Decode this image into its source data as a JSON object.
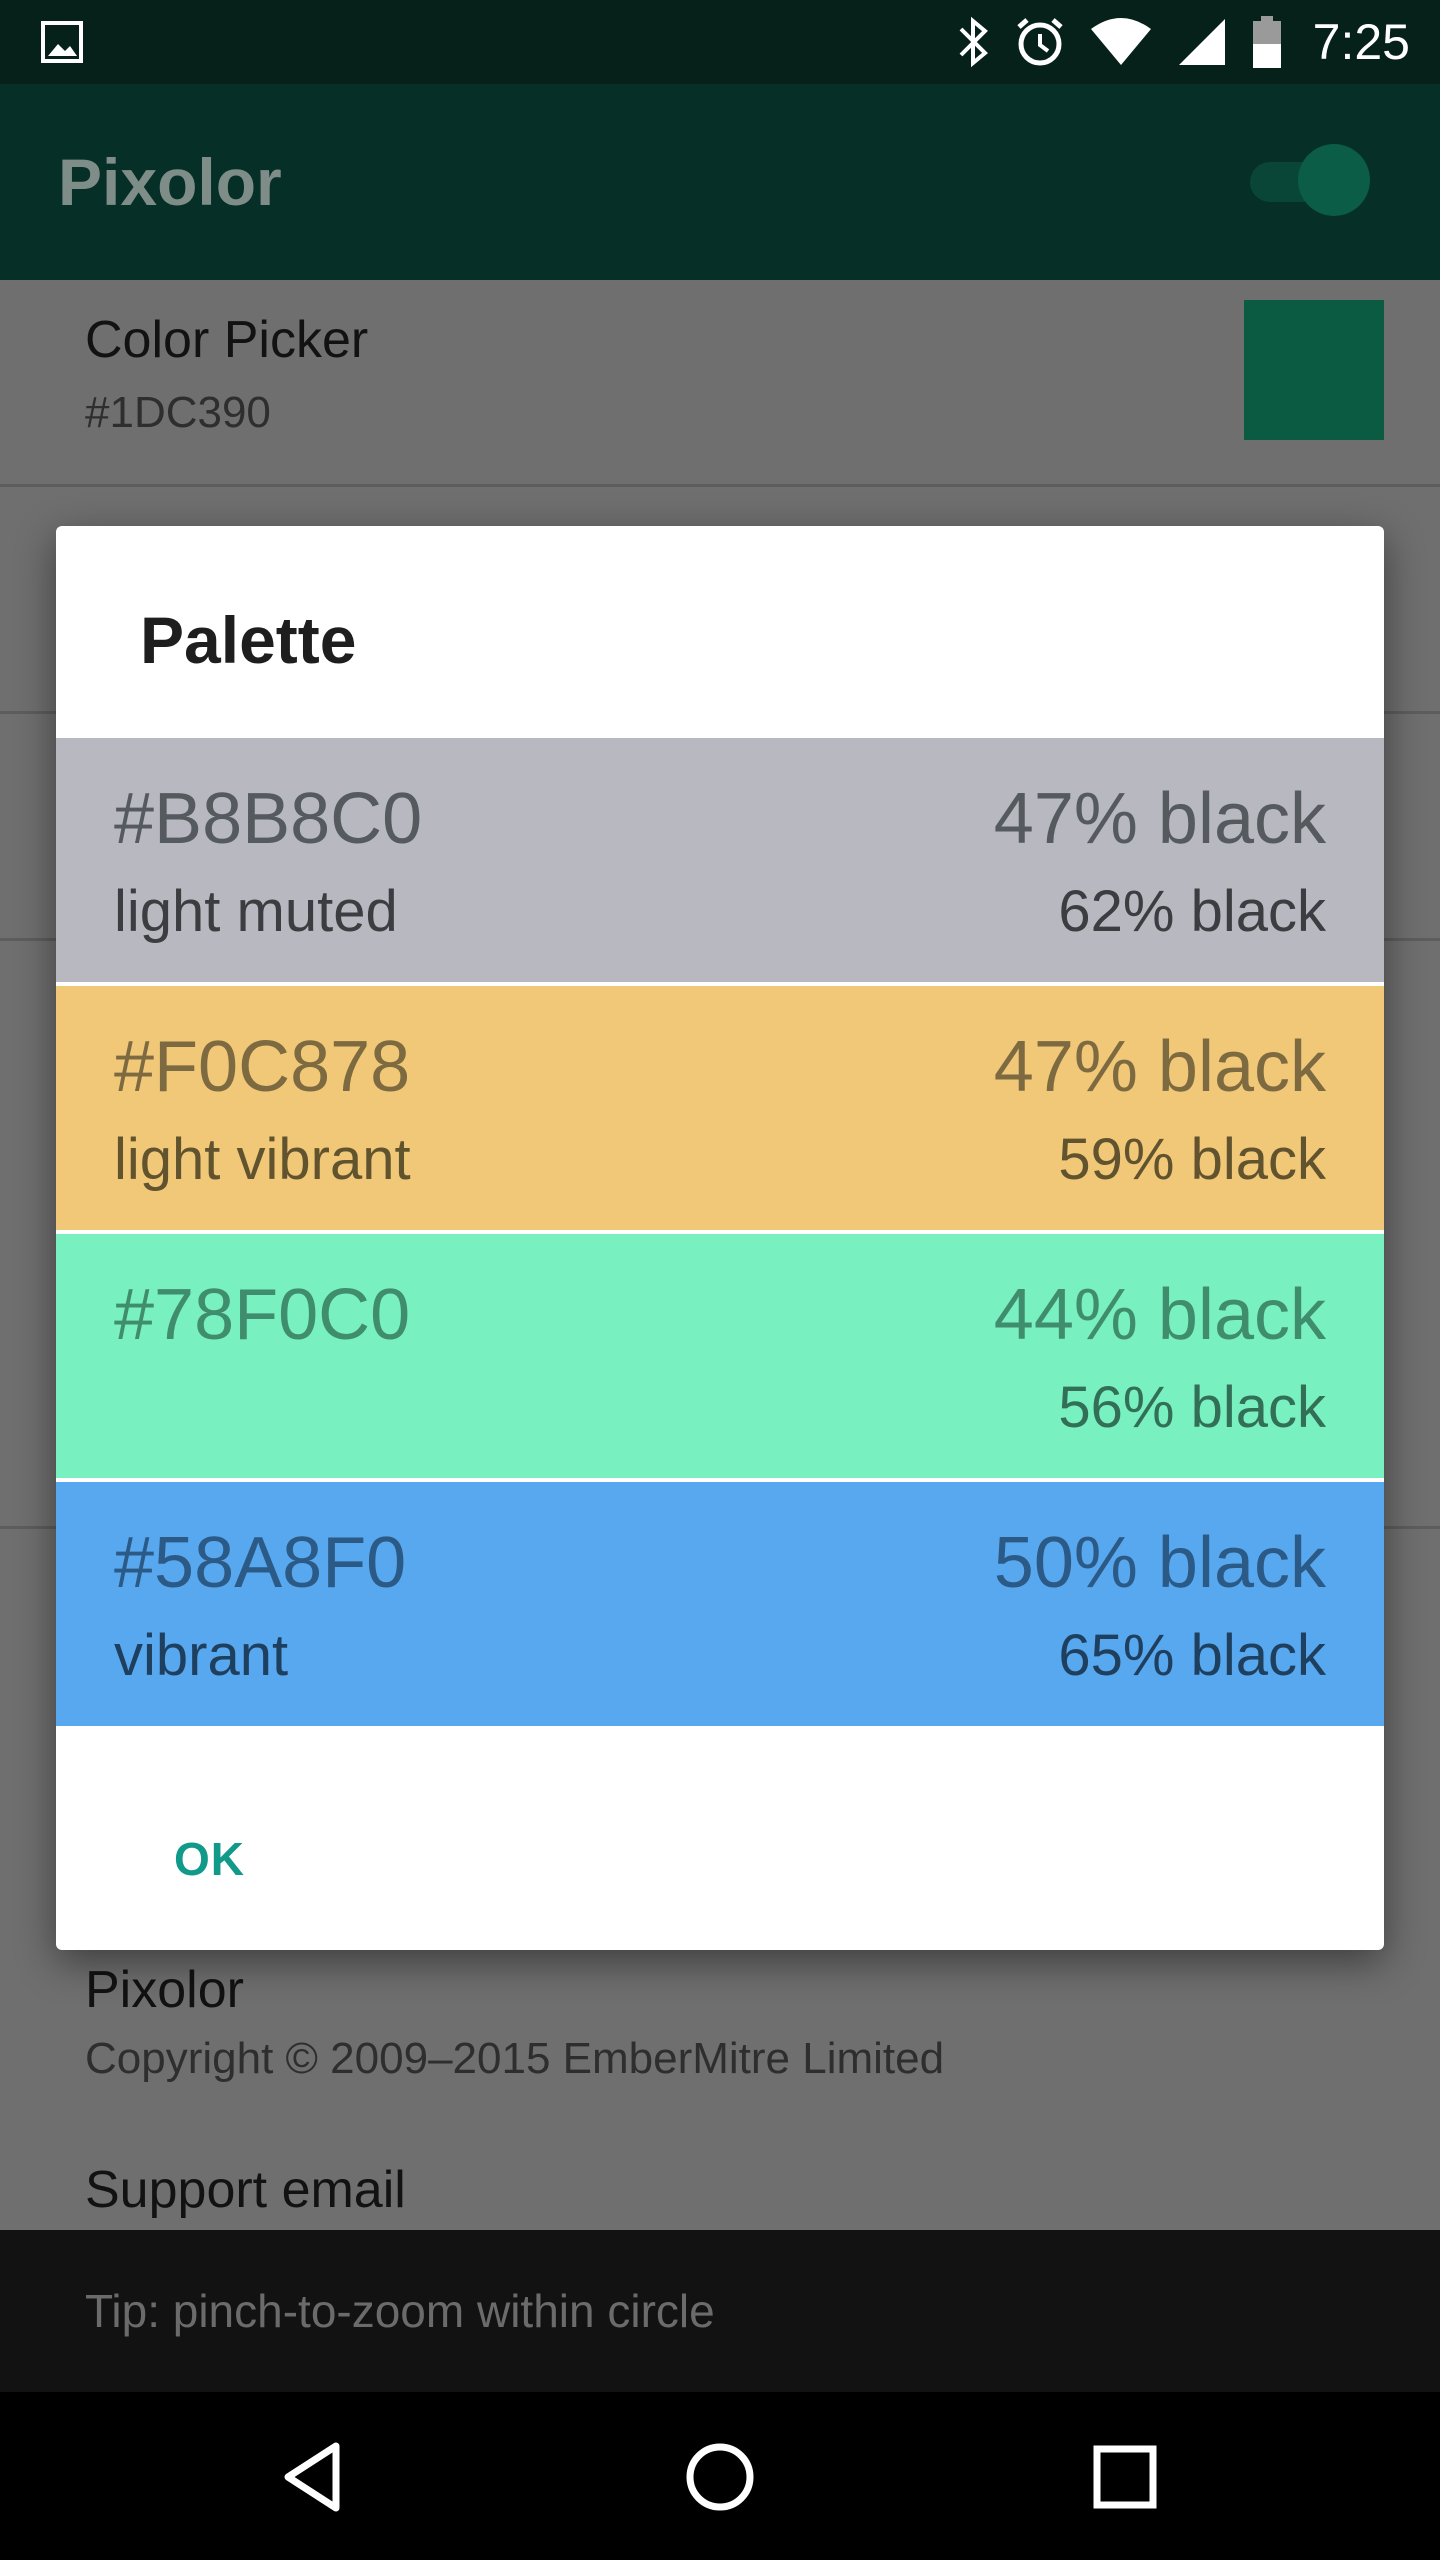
{
  "status_bar": {
    "time": "7:25",
    "icons": [
      "image-icon",
      "bluetooth-icon",
      "alarm-icon",
      "wifi-icon",
      "signal-icon",
      "battery-icon"
    ]
  },
  "toolbar": {
    "title": "Pixolor",
    "toggle_on": true
  },
  "background": {
    "color_picker_title": "Color Picker",
    "color_picker_value": "#1DC390",
    "about_title": "Pixolor",
    "about_copyright": "Copyright © 2009–2015 EmberMitre Limited",
    "support_title": "Support email",
    "tip": "Tip: pinch-to-zoom within circle"
  },
  "dialog": {
    "title": "Palette",
    "ok_label": "OK",
    "swatches": [
      {
        "hex": "#B8B8C0",
        "name": "light muted",
        "title_contrast": "47% black",
        "body_contrast": "62% black",
        "bg": "#b8b8c0",
        "text": "#555a5e",
        "name_text": "#3b3d40"
      },
      {
        "hex": "#F0C878",
        "name": "light vibrant",
        "title_contrast": "47% black",
        "body_contrast": "59% black",
        "bg": "#f0c878",
        "text": "#7e6a40",
        "name_text": "#62532f"
      },
      {
        "hex": "#78F0C0",
        "name": "",
        "title_contrast": "44% black",
        "body_contrast": "56% black",
        "bg": "#78f0c0",
        "text": "#408d6d",
        "name_text": "#336f57"
      },
      {
        "hex": "#58A8F0",
        "name": "vibrant",
        "title_contrast": "50% black",
        "body_contrast": "65% black",
        "bg": "#58a8f0",
        "text": "#2c5a86",
        "name_text": "#1f3f5e"
      }
    ]
  },
  "colors": {
    "accent": "#119a8a",
    "swatch_color_picker": "#0b5a42"
  }
}
